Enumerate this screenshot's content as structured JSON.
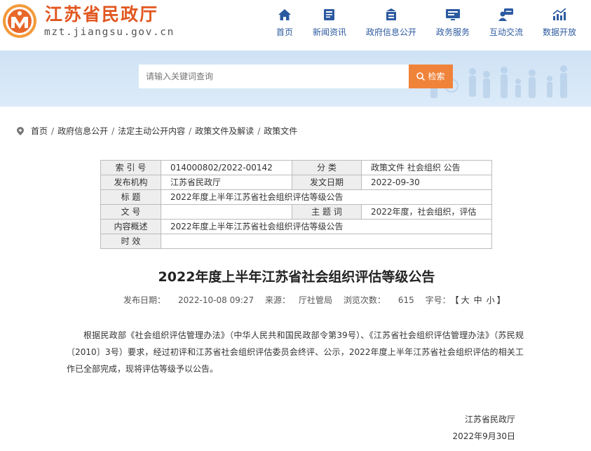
{
  "header": {
    "site_name": "江苏省民政厅",
    "site_domain": "mzt.jiangsu.gov.cn",
    "nav": [
      {
        "label": "首页",
        "icon": "home-icon"
      },
      {
        "label": "新闻资讯",
        "icon": "news-icon"
      },
      {
        "label": "政府信息公开",
        "icon": "building-icon"
      },
      {
        "label": "政务服务",
        "icon": "monitor-icon"
      },
      {
        "label": "互动交流",
        "icon": "chat-user-icon"
      },
      {
        "label": "数据开放",
        "icon": "bar-chart-icon"
      }
    ]
  },
  "search": {
    "placeholder": "请输入关键词查询",
    "button_label": "检索"
  },
  "breadcrumb": [
    "首页",
    "政府信息公开",
    "法定主动公开内容",
    "政策文件及解读",
    "政策文件"
  ],
  "meta_table": {
    "index_label": "索 引 号",
    "index_value": "014000802/2022-00142",
    "category_label": "分 类",
    "category_value": "政策文件 社会组织 公告",
    "publisher_label": "发布机构",
    "publisher_value": "江苏省民政厅",
    "date_label": "发文日期",
    "date_value": "2022-09-30",
    "title_label": "标 题",
    "title_value": "2022年度上半年江苏省社会组织评估等级公告",
    "docno_label": "文 号",
    "docno_value": "",
    "keywords_label": "主 题 词",
    "keywords_value": "2022年度，社会组织，评估",
    "summary_label": "内容概述",
    "summary_value": "2022年度上半年江苏省社会组织评估等级公告",
    "validity_label": "时 效",
    "validity_value": ""
  },
  "article": {
    "title": "2022年度上半年江苏省社会组织评估等级公告",
    "publish_label": "发布日期：",
    "publish_date": "2022-10-08 09:27",
    "source_label": "来源：",
    "source": "厅社管局",
    "views_label": "浏览次数：",
    "views": "615",
    "fontsize_label": "字号：",
    "fontsize_open": "【",
    "font_large": "大",
    "font_medium": "中",
    "font_small": "小",
    "fontsize_close": "】",
    "body": "根据民政部《社会组织评估管理办法》（中华人民共和国民政部令第39号）、《江苏省社会组织评估管理办法》（苏民规〔2010〕3号）要求，经过初评和江苏省社会组织评估委员会终评、公示，2022年度上半年江苏省社会组织评估的相关工作已全部完成，现将评估等级予以公告。",
    "signature": "江苏省民政厅",
    "sign_date": "2022年9月30日"
  },
  "colors": {
    "brand_orange": "#e1571f",
    "nav_blue": "#2c5aa0",
    "search_button": "#f0833a",
    "banner_bg": "#cfe2f5"
  }
}
